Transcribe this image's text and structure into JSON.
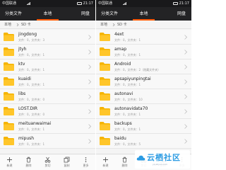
{
  "left_screen": {
    "status": {
      "carrier": "中国联通",
      "time": "21:17"
    },
    "tabs": {
      "category": "分类文件",
      "local": "本地",
      "cloud": "网盘"
    },
    "breadcrumb": {
      "root": "本地",
      "current": "SD 卡"
    },
    "items": [
      {
        "name": "jingdong",
        "meta": "文件：0，文件夹：3"
      },
      {
        "name": "jtyh",
        "meta": "文件：0，文件夹：1"
      },
      {
        "name": "ktv",
        "meta": "文件：0，文件夹：1"
      },
      {
        "name": "kuaidi",
        "meta": "文件：0，文件夹：1"
      },
      {
        "name": "libs",
        "meta": "文件：0，文件夹：0"
      },
      {
        "name": "LOST.DIR",
        "meta": "文件：0，文件夹：0"
      },
      {
        "name": "meituanwaimai",
        "meta": "文件：0，文件夹：1"
      },
      {
        "name": "mipush",
        "meta": "文件：0，文件夹：1"
      }
    ],
    "actions": [
      "新建",
      "删除",
      "剪切",
      "复制",
      "更多"
    ]
  },
  "right_screen": {
    "status": {
      "carrier": "中国联通",
      "time": "21:17"
    },
    "tabs": {
      "category": "分类文件",
      "local": "本地",
      "cloud": "网盘"
    },
    "breadcrumb": {
      "root": "本地",
      "current": "SD 卡"
    },
    "items": [
      {
        "name": "4ext",
        "meta": "文件：0，文件夹：1"
      },
      {
        "name": "amap",
        "meta": "文件：0，文件夹：1"
      },
      {
        "name": "Android",
        "meta": "文件：0，文件夹：2（隐藏文件夹）"
      },
      {
        "name": "apsapiyunpingtai",
        "meta": "文件：0，文件夹：1"
      },
      {
        "name": "autonavi",
        "meta": "文件：0，文件夹：10"
      },
      {
        "name": "autonavidata70",
        "meta": "文件：0，文件夹：1"
      },
      {
        "name": "backups",
        "meta": "文件：0，文件夹：1"
      },
      {
        "name": "baidu",
        "meta": "文件：0，文件夹：5"
      }
    ],
    "actions": [
      "新建",
      "删除",
      "剪切",
      "复制",
      "更多"
    ]
  },
  "watermark": {
    "text": "云栖社区",
    "sub": "yq.aliyun.com"
  },
  "colors": {
    "accent": "#ff5a00",
    "folder": "#f5b400",
    "header_bg": "#232325",
    "status_bg": "#19191b",
    "watermark": "#2b9be3"
  },
  "icons": {
    "folder": "folder-icon",
    "chevron": "chevron-right-icon",
    "new": "plus-icon",
    "delete": "trash-icon",
    "cut": "scissors-icon",
    "copy": "copy-icon",
    "more": "more-icon"
  }
}
